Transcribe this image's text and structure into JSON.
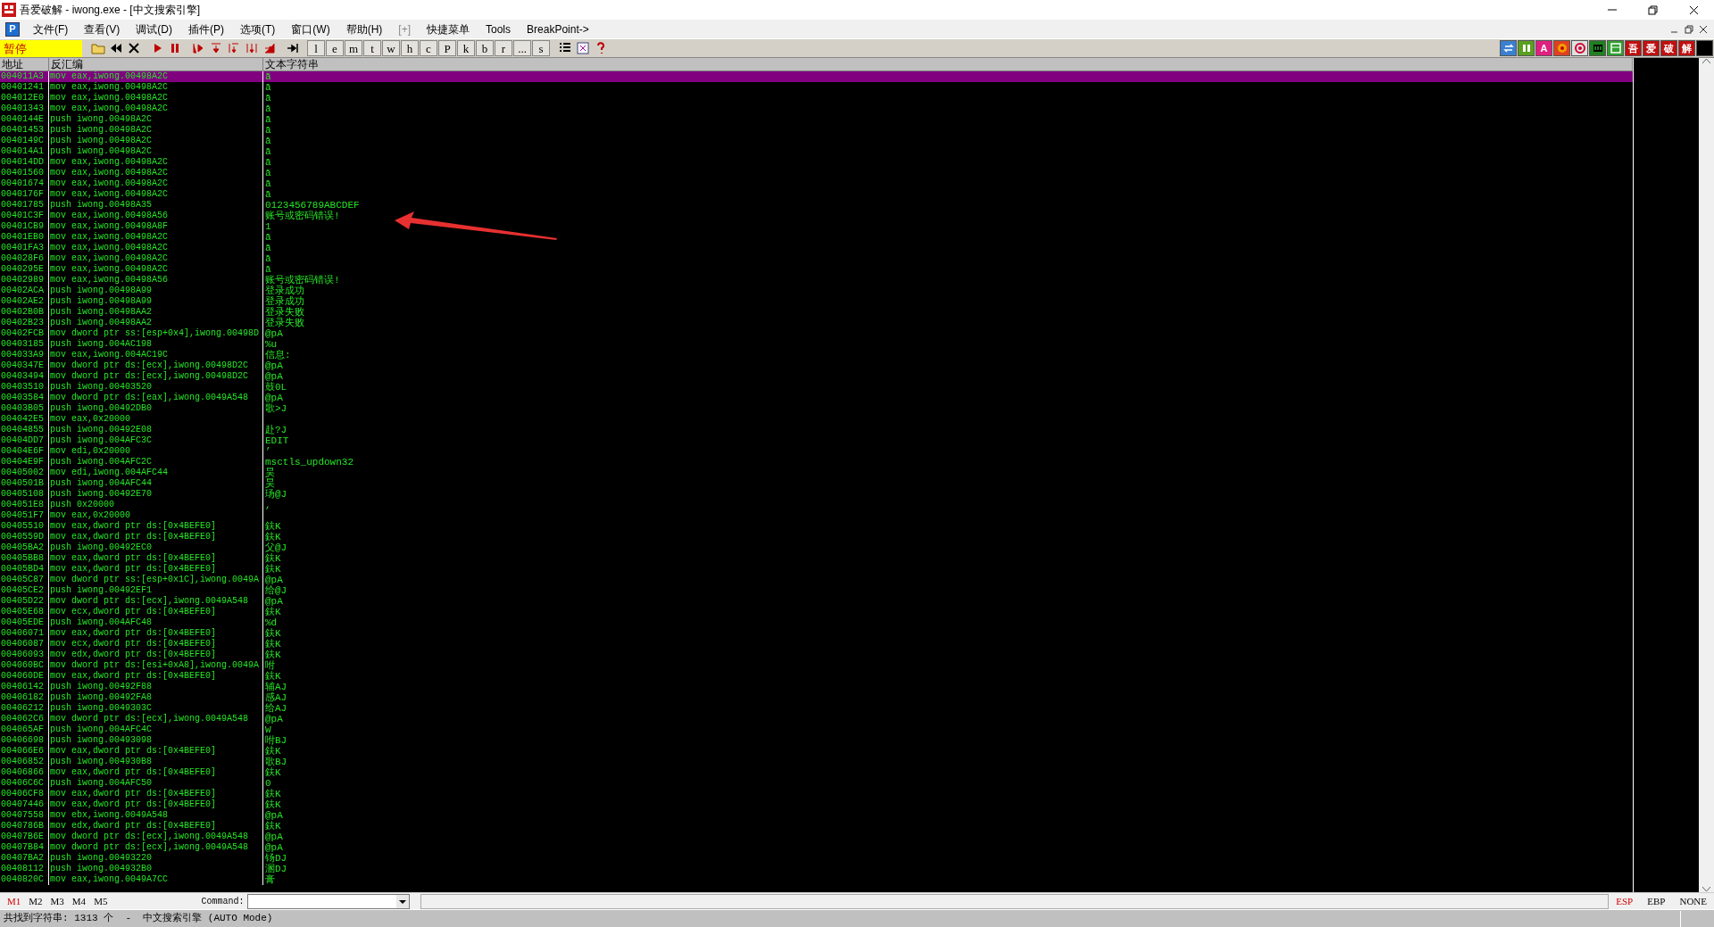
{
  "window": {
    "title": "吾爱破解 - iwong.exe - [中文搜索引擎]"
  },
  "menu": {
    "app_letter": "P",
    "items": [
      {
        "label": "文件(F)",
        "disabled": false
      },
      {
        "label": "查看(V)",
        "disabled": false
      },
      {
        "label": "调试(D)",
        "disabled": false
      },
      {
        "label": "插件(P)",
        "disabled": false
      },
      {
        "label": "选项(T)",
        "disabled": false
      },
      {
        "label": "窗口(W)",
        "disabled": false
      },
      {
        "label": "帮助(H)",
        "disabled": false
      },
      {
        "label": "[+]",
        "disabled": true
      },
      {
        "label": "快捷菜单",
        "disabled": false
      },
      {
        "label": "Tools",
        "disabled": false
      },
      {
        "label": "BreakPoint->",
        "disabled": false
      }
    ]
  },
  "toolbar": {
    "state_label": "暂停",
    "letter_buttons": [
      "l",
      "e",
      "m",
      "t",
      "w",
      "h",
      "c",
      "P",
      "k",
      "b",
      "r",
      "...",
      "s"
    ],
    "right_letter_buttons": [
      "A",
      "吾",
      "爱",
      "破",
      "解"
    ]
  },
  "table": {
    "columns": [
      "地址",
      "反汇编",
      "文本字符串"
    ],
    "rows": [
      {
        "address": "004011A3",
        "disassembly": "mov eax,iwong.00498A2C",
        "text": "ā",
        "selected": true
      },
      {
        "address": "00401241",
        "disassembly": "mov eax,iwong.00498A2C",
        "text": "ā",
        "selected": false
      },
      {
        "address": "004012E0",
        "disassembly": "mov eax,iwong.00498A2C",
        "text": "ā",
        "selected": false
      },
      {
        "address": "00401343",
        "disassembly": "mov eax,iwong.00498A2C",
        "text": "ā",
        "selected": false
      },
      {
        "address": "0040144E",
        "disassembly": "push iwong.00498A2C",
        "text": "ā",
        "selected": false
      },
      {
        "address": "00401453",
        "disassembly": "push iwong.00498A2C",
        "text": "ā",
        "selected": false
      },
      {
        "address": "0040149C",
        "disassembly": "push iwong.00498A2C",
        "text": "ā",
        "selected": false
      },
      {
        "address": "004014A1",
        "disassembly": "push iwong.00498A2C",
        "text": "ā",
        "selected": false
      },
      {
        "address": "004014DD",
        "disassembly": "mov eax,iwong.00498A2C",
        "text": "ā",
        "selected": false
      },
      {
        "address": "00401560",
        "disassembly": "mov eax,iwong.00498A2C",
        "text": "ā",
        "selected": false
      },
      {
        "address": "00401674",
        "disassembly": "mov eax,iwong.00498A2C",
        "text": "ā",
        "selected": false
      },
      {
        "address": "0040176F",
        "disassembly": "mov eax,iwong.00498A2C",
        "text": "ā",
        "selected": false
      },
      {
        "address": "00401785",
        "disassembly": "push iwong.00498A35",
        "text": "0123456789ABCDEF",
        "selected": false
      },
      {
        "address": "00401C3F",
        "disassembly": "mov eax,iwong.00498A56",
        "text": "账号或密码错误!",
        "selected": false
      },
      {
        "address": "00401CB9",
        "disassembly": "mov eax,iwong.00498A8F",
        "text": "1",
        "selected": false
      },
      {
        "address": "00401EB0",
        "disassembly": "mov eax,iwong.00498A2C",
        "text": "ā",
        "selected": false
      },
      {
        "address": "00401FA3",
        "disassembly": "mov eax,iwong.00498A2C",
        "text": "ā",
        "selected": false
      },
      {
        "address": "004028F6",
        "disassembly": "mov eax,iwong.00498A2C",
        "text": "ā",
        "selected": false
      },
      {
        "address": "0040295E",
        "disassembly": "mov eax,iwong.00498A2C",
        "text": "ā",
        "selected": false
      },
      {
        "address": "00402989",
        "disassembly": "mov eax,iwong.00498A56",
        "text": "账号或密码错误!",
        "selected": false
      },
      {
        "address": "00402ACA",
        "disassembly": "push iwong.00498A99",
        "text": "登录成功",
        "selected": false
      },
      {
        "address": "00402AE2",
        "disassembly": "push iwong.00498A99",
        "text": "登录成功",
        "selected": false
      },
      {
        "address": "00402B0B",
        "disassembly": "push iwong.00498AA2",
        "text": "登录失败",
        "selected": false
      },
      {
        "address": "00402B23",
        "disassembly": "push iwong.00498AA2",
        "text": "登录失败",
        "selected": false
      },
      {
        "address": "00402FCB",
        "disassembly": "mov dword ptr ss:[esp+0x4],iwong.00498D",
        "text": "@pA",
        "selected": false
      },
      {
        "address": "00403185",
        "disassembly": "push iwong.004AC198",
        "text": "%u",
        "selected": false
      },
      {
        "address": "004033A9",
        "disassembly": "mov eax,iwong.004AC19C",
        "text": "信息:",
        "selected": false
      },
      {
        "address": "0040347E",
        "disassembly": "mov dword ptr ds:[ecx],iwong.00498D2C",
        "text": "@pA",
        "selected": false
      },
      {
        "address": "00403494",
        "disassembly": "mov dword ptr ds:[ecx],iwong.00498D2C",
        "text": "@pA",
        "selected": false
      },
      {
        "address": "00403510",
        "disassembly": "push iwong.00403520",
        "text": "鼓0L",
        "selected": false
      },
      {
        "address": "00403584",
        "disassembly": "mov dword ptr ds:[eax],iwong.0049A548",
        "text": "@pA",
        "selected": false
      },
      {
        "address": "00403B05",
        "disassembly": "push iwong.00492DB0",
        "text": "歌>J",
        "selected": false
      },
      {
        "address": "004042E5",
        "disassembly": "mov eax,0x20000",
        "selected": false
      },
      {
        "address": "00404855",
        "disassembly": "push iwong.00492E08",
        "text": "赴?J",
        "selected": false
      },
      {
        "address": "00404DD7",
        "disassembly": "push iwong.004AFC3C",
        "text": "EDIT",
        "selected": false
      },
      {
        "address": "00404E6F",
        "disassembly": "mov edi,0x20000",
        "text": "’",
        "selected": false
      },
      {
        "address": "00404E9F",
        "disassembly": "push iwong.004AFC2C",
        "text": "msctls_updown32",
        "selected": false
      },
      {
        "address": "00405002",
        "disassembly": "mov edi,iwong.004AFC44",
        "text": "昊",
        "selected": false
      },
      {
        "address": "0040501B",
        "disassembly": "push iwong.004AFC44",
        "text": "昊",
        "selected": false
      },
      {
        "address": "00405108",
        "disassembly": "push iwong.00492E70",
        "text": "玚@J",
        "selected": false
      },
      {
        "address": "004051E8",
        "disassembly": "push 0x20000",
        "text": ",",
        "selected": false
      },
      {
        "address": "004051F7",
        "disassembly": "mov eax,0x20000",
        "selected": false
      },
      {
        "address": "00405510",
        "disassembly": "mov eax,dword ptr ds:[0x4BEFE0]",
        "text": "鈇K",
        "selected": false
      },
      {
        "address": "0040559D",
        "disassembly": "mov eax,dword ptr ds:[0x4BEFE0]",
        "text": "鈇K",
        "selected": false
      },
      {
        "address": "00405BA2",
        "disassembly": "push iwong.00492EC0",
        "text": "父@J",
        "selected": false
      },
      {
        "address": "00405BB8",
        "disassembly": "mov eax,dword ptr ds:[0x4BEFE0]",
        "text": "鈇K",
        "selected": false
      },
      {
        "address": "00405BD4",
        "disassembly": "mov eax,dword ptr ds:[0x4BEFE0]",
        "text": "鈇K",
        "selected": false
      },
      {
        "address": "00405C87",
        "disassembly": "mov dword ptr ss:[esp+0x1C],iwong.0049A",
        "text": "@pA",
        "selected": false
      },
      {
        "address": "00405CE2",
        "disassembly": "push iwong.00492EF1",
        "text": "给@J",
        "selected": false
      },
      {
        "address": "00405D22",
        "disassembly": "mov dword ptr ds:[ecx],iwong.0049A548",
        "text": "@pA",
        "selected": false
      },
      {
        "address": "00405E68",
        "disassembly": "mov ecx,dword ptr ds:[0x4BEFE0]",
        "text": "鈇K",
        "selected": false
      },
      {
        "address": "00405EDE",
        "disassembly": "push iwong.004AFC48",
        "text": "%d",
        "selected": false
      },
      {
        "address": "00406071",
        "disassembly": "mov eax,dword ptr ds:[0x4BEFE0]",
        "text": "鈇K",
        "selected": false
      },
      {
        "address": "00406087",
        "disassembly": "mov ecx,dword ptr ds:[0x4BEFE0]",
        "text": "鈇K",
        "selected": false
      },
      {
        "address": "00406093",
        "disassembly": "mov edx,dword ptr ds:[0x4BEFE0]",
        "text": "鈇K",
        "selected": false
      },
      {
        "address": "004060BC",
        "disassembly": "mov dword ptr ds:[esi+0xA8],iwong.0049A",
        "text": "咐",
        "selected": false
      },
      {
        "address": "004060DE",
        "disassembly": "mov eax,dword ptr ds:[0x4BEFE0]",
        "text": "鈇K",
        "selected": false
      },
      {
        "address": "00406142",
        "disassembly": "push iwong.00492F88",
        "text": "辅AJ",
        "selected": false
      },
      {
        "address": "00406182",
        "disassembly": "push iwong.00492FA8",
        "text": "感AJ",
        "selected": false
      },
      {
        "address": "00406212",
        "disassembly": "push iwong.0049303C",
        "text": "给AJ",
        "selected": false
      },
      {
        "address": "004062C6",
        "disassembly": "mov dword ptr ds:[ecx],iwong.0049A548",
        "text": "@pA",
        "selected": false
      },
      {
        "address": "004065AF",
        "disassembly": "push iwong.004AFC4C",
        "text": "W",
        "selected": false
      },
      {
        "address": "00406698",
        "disassembly": "push iwong.00493098",
        "text": "咐BJ",
        "selected": false
      },
      {
        "address": "004066E6",
        "disassembly": "mov eax,dword ptr ds:[0x4BEFE0]",
        "text": "鈇K",
        "selected": false
      },
      {
        "address": "00406852",
        "disassembly": "push iwong.004930B8",
        "text": "歌BJ",
        "selected": false
      },
      {
        "address": "00406866",
        "disassembly": "mov eax,dword ptr ds:[0x4BEFE0]",
        "text": "鈇K",
        "selected": false
      },
      {
        "address": "00406C6C",
        "disassembly": "push iwong.004AFC50",
        "text": "0",
        "selected": false
      },
      {
        "address": "00406CF8",
        "disassembly": "mov eax,dword ptr ds:[0x4BEFE0]",
        "text": "鈇K",
        "selected": false
      },
      {
        "address": "00407446",
        "disassembly": "mov eax,dword ptr ds:[0x4BEFE0]",
        "text": "鈇K",
        "selected": false
      },
      {
        "address": "00407558",
        "disassembly": "mov ebx,iwong.0049A548",
        "text": "@pA",
        "selected": false
      },
      {
        "address": "0040786B",
        "disassembly": "mov edx,dword ptr ds:[0x4BEFE0]",
        "text": "鈇K",
        "selected": false
      },
      {
        "address": "00407B6E",
        "disassembly": "mov dword ptr ds:[ecx],iwong.0049A548",
        "text": "@pA",
        "selected": false
      },
      {
        "address": "00407B84",
        "disassembly": "mov dword ptr ds:[ecx],iwong.0049A548",
        "text": "@pA",
        "selected": false
      },
      {
        "address": "00407BA2",
        "disassembly": "push iwong.00493220",
        "text": "钖DJ",
        "selected": false
      },
      {
        "address": "00408112",
        "disassembly": "push iwong.004932B0",
        "text": "溷DJ",
        "selected": false
      },
      {
        "address": "0040820C",
        "disassembly": "mov eax,iwong.0049A7CC",
        "text": "膏",
        "selected": false
      }
    ]
  },
  "command_bar": {
    "marks": [
      {
        "label": "M1",
        "selected": true
      },
      {
        "label": "M2",
        "selected": false
      },
      {
        "label": "M3",
        "selected": false
      },
      {
        "label": "M4",
        "selected": false
      },
      {
        "label": "M5",
        "selected": false
      }
    ],
    "command_label": "Command:",
    "registers": [
      {
        "label": "ESP",
        "selected": true
      },
      {
        "label": "EBP",
        "selected": false
      },
      {
        "label": "NONE",
        "selected": false
      }
    ]
  },
  "status_bar": {
    "text": "共找到字符串: 1313 个  -  中文搜索引擎 (AUTO Mode)"
  }
}
